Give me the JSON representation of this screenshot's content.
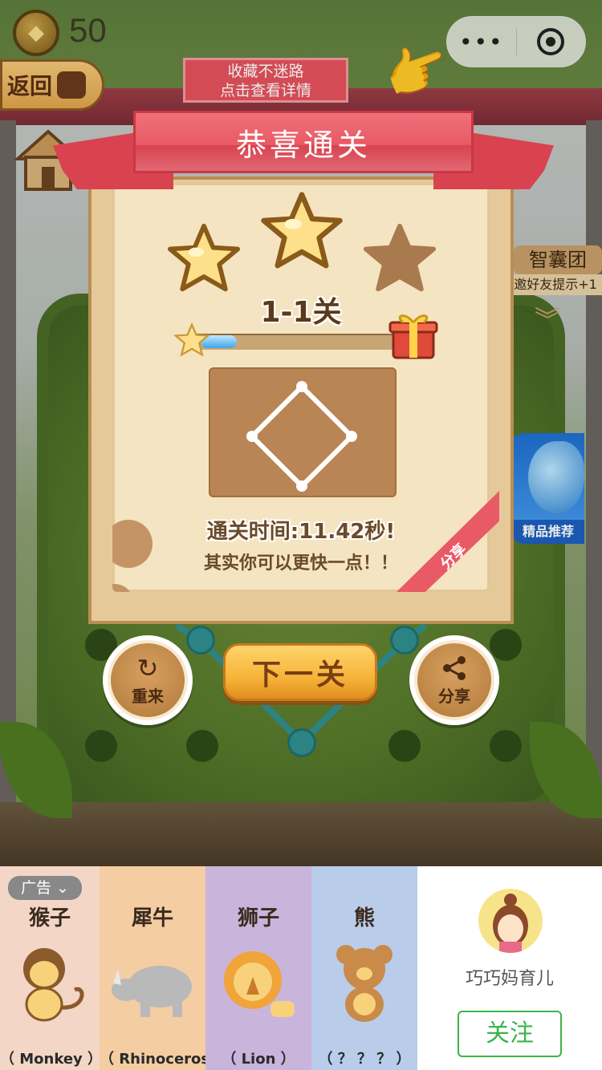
{
  "hud": {
    "coin_count": "50",
    "back_label": "返回",
    "capsule_more": "•••"
  },
  "tip": {
    "line1": "收藏不迷路",
    "line2": "点击查看详情"
  },
  "side": {
    "brain_title": "智囊团",
    "brain_sub": "邀好友提示+1",
    "promo_label": "精品推荐"
  },
  "result": {
    "banner": "恭喜通关",
    "level": "1-1关",
    "stars_earned": 2,
    "stars_total": 3,
    "progress": 0.12,
    "time_text": "通关时间:11.42秒!",
    "encourage": "其实你可以更快一点！！",
    "share_corner": "分享"
  },
  "actions": {
    "retry_label": "重来",
    "next_label": "下一关",
    "share_label": "分享"
  },
  "ad": {
    "tag": "广告",
    "cards": [
      {
        "cn": "猴子",
        "en": "（  Monkey  ）",
        "bg": "#f3d6c6"
      },
      {
        "cn": "犀牛",
        "en": "（ Rhinoceros ）",
        "bg": "#f4cda2"
      },
      {
        "cn": "狮子",
        "en": "（     Lion     ）",
        "bg": "#c9b4dc"
      },
      {
        "cn": "熊",
        "en": "（  ？ ？ ？  ）",
        "bg": "#b9cdea"
      }
    ],
    "account_name": "巧巧妈育儿",
    "follow_label": "关注"
  },
  "colors": {
    "ribbon": "#e85a66",
    "button_gold": "#f7b43a",
    "follow_green": "#3cb44a"
  }
}
